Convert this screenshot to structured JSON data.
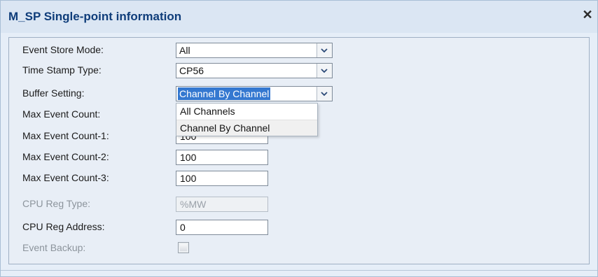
{
  "dialog": {
    "title": "M_SP Single-point information",
    "close_glyph": "✕"
  },
  "fields": {
    "event_store_mode": {
      "label": "Event Store Mode:",
      "value": "All"
    },
    "time_stamp_type": {
      "label": "Time Stamp Type:",
      "value": "CP56"
    },
    "buffer_setting": {
      "label": "Buffer Setting:",
      "value": "Channel By Channel"
    },
    "max_event_count": {
      "label": "Max Event Count:"
    },
    "max_event_count_1": {
      "label": "Max Event Count-1:",
      "value": "100"
    },
    "max_event_count_2": {
      "label": "Max Event Count-2:",
      "value": "100"
    },
    "max_event_count_3": {
      "label": "Max Event Count-3:",
      "value": "100"
    },
    "cpu_reg_type": {
      "label": "CPU Reg Type:",
      "value": "%MW"
    },
    "cpu_reg_address": {
      "label": "CPU Reg Address:",
      "value": "0"
    },
    "event_backup": {
      "label": "Event Backup:",
      "checked": false
    }
  },
  "buffer_dropdown": {
    "options": [
      "All Channels",
      "Channel By Channel"
    ],
    "hovered": "Channel By Channel"
  },
  "icons": {
    "close": "close-icon",
    "dropdown": "chevron-down-icon"
  },
  "colors": {
    "title": "#0f3d7a",
    "selection": "#3478d0",
    "background": "#e6eef8"
  }
}
